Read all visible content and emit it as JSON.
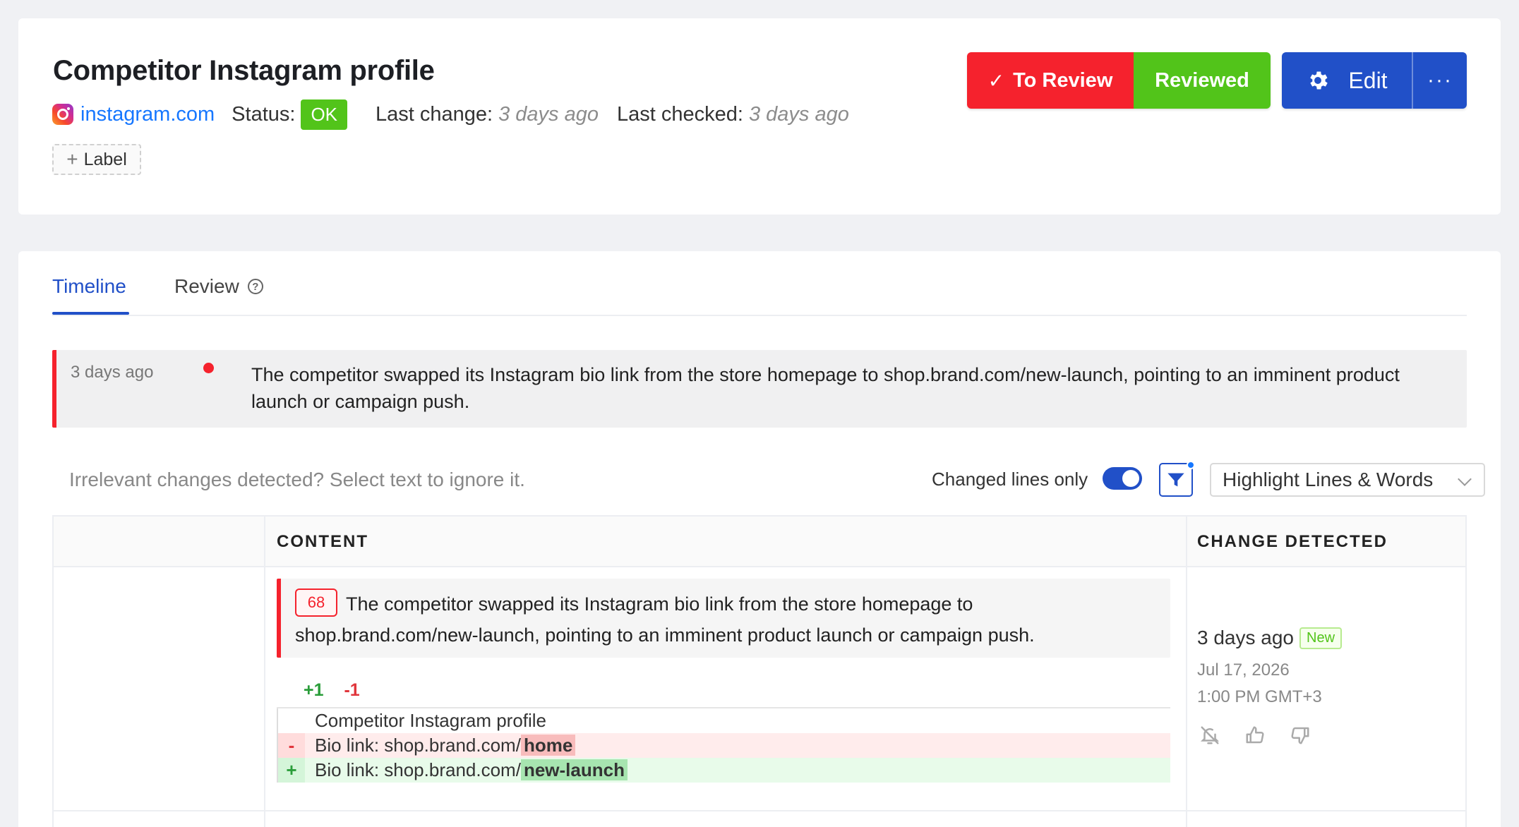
{
  "header": {
    "title": "Competitor Instagram profile",
    "site_link": "instagram.com",
    "status_label": "Status:",
    "status_value": "OK",
    "last_change_label": "Last change:",
    "last_change_value": "3 days ago",
    "last_checked_label": "Last checked:",
    "last_checked_value": "3 days ago",
    "label_button": "Label",
    "to_review_button": "To Review",
    "reviewed_button": "Reviewed",
    "edit_button": "Edit",
    "more_button": "···"
  },
  "tabs": [
    {
      "label": "Timeline",
      "active": true
    },
    {
      "label": "Review",
      "active": false
    }
  ],
  "summary": {
    "time": "3 days ago",
    "text": "The competitor swapped its Instagram bio link from the store homepage to shop.brand.com/new-launch, pointing to an imminent product launch or campaign push."
  },
  "toolbar": {
    "hint": "Irrelevant changes detected? Select text to ignore it.",
    "changed_lines_label": "Changed lines only",
    "highlight_select": "Highlight Lines & Words"
  },
  "table": {
    "columns": [
      "",
      "CONTENT",
      "CHANGE DETECTED"
    ],
    "row": {
      "badge": "68",
      "change_text": "The competitor swapped its Instagram bio link from the store homepage to shop.brand.com/new-launch, pointing to an imminent product launch or campaign push.",
      "added": "+1",
      "removed": "-1",
      "diff": {
        "context": "Competitor Instagram profile",
        "del_marker": "-",
        "del_prefix": "Bio link: shop.brand.com/",
        "del_word": "home",
        "add_marker": "+",
        "add_prefix": "Bio link: shop.brand.com/",
        "add_word": "new-launch"
      },
      "detected_time": "3 days ago",
      "new_badge": "New",
      "detected_date": "Jul 17, 2026",
      "detected_hour": "1:00 PM GMT+3"
    }
  },
  "colors": {
    "primary": "#2150c8",
    "danger": "#f5222d",
    "success": "#52c41a",
    "link": "#1677ff"
  }
}
